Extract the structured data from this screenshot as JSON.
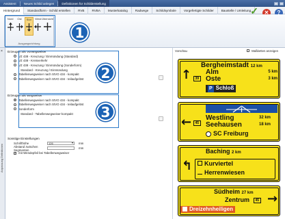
{
  "titlebar": {
    "tabs": [
      "Assistent",
      "Neues Schild anlegen",
      "Definitionen für Schilderstellung"
    ]
  },
  "menubar": {
    "items": [
      "Hintergrund",
      "Standardform - Schild erstellen",
      "RVB",
      "RVBA",
      "Musterkatalog",
      "Radwege",
      "Schildsymbole",
      "Vorgefertigte Schilder",
      "Baustelle / Umleitung"
    ],
    "active_index": 0,
    "confirm_icon": "check-icon",
    "cancel_icon": "close-icon",
    "help_label": "?"
  },
  "ribbon": {
    "buttons": [
      "Nord",
      "Ost",
      "Süd",
      "West",
      "Übersicht"
    ],
    "selected": 2,
    "group_label": "Ausgangsrichtung"
  },
  "callouts": [
    "1",
    "2",
    "3"
  ],
  "sidetab": {
    "close": "×",
    "label": "Anpassung Definitionen"
  },
  "vorwegweiser": {
    "header": "Erzeugen als Vorwegweiser",
    "options": [
      {
        "label": "VZ 438 - Kreuzung / Einmündung (Standard)",
        "sub": false,
        "on": false
      },
      {
        "label": "VZ 438 - Kreisverkehr",
        "sub": false,
        "on": false
      },
      {
        "label": "VZ 438 - Kreuzung / Einmündung (Sonderform)",
        "sub": false,
        "on": false
      },
      {
        "label": "Standard - Kreuzung / Einmündung",
        "sub": true,
        "on": false
      },
      {
        "label": "Tabellenwegweiser nach StVO 434 - kompakt",
        "sub": false,
        "on": false
      },
      {
        "label": "Tabellenwegweiser nach StVO 434 - teilaufgelöst",
        "sub": false,
        "on": false
      }
    ]
  },
  "wegweiser": {
    "header": "Erzeugen als Wegweiser",
    "options": [
      {
        "label": "Tabellenwegweiser nach StVO 434 - kompakt",
        "sub": false,
        "on": true
      },
      {
        "label": "Tabellenwegweiser nach StVO 434 - teilaufgelöst",
        "sub": false,
        "on": false
      },
      {
        "label": "Sonderform",
        "sub": false,
        "on": false
      },
      {
        "label": "Standard - Tabellenwegweiser-kompakt",
        "sub": true,
        "on": false
      }
    ]
  },
  "settings": {
    "header": "Sonstige Einstellungen",
    "font_size_label": "Schrifthöhe",
    "font_size_value": "126",
    "font_size_unit": "mm",
    "spacing_label": "Abstand zwischen Segmenten",
    "spacing_value": "",
    "spacing_unit": "mm",
    "checkbox_label": "mit Wendepfeil bei Tabellenwegweiser",
    "checkbox_checked": true
  },
  "preview": {
    "label": "Vorschau",
    "checkbox_label": "Maßketten anzeigen",
    "sign1": {
      "rows": [
        {
          "name": "Bergheimstadt",
          "km": "12 km"
        },
        {
          "name": "Alm",
          "km": "5 km"
        },
        {
          "name": "Oste",
          "km": "3 km"
        }
      ],
      "route": "39",
      "poi": "Schloß",
      "poi_icon": "P"
    },
    "sign2": {
      "rows": [
        {
          "name": "Westling",
          "km": "32 km"
        },
        {
          "name": "Seehausen",
          "km": "18 km"
        }
      ],
      "route": "45",
      "poi": "SC Freiburg"
    },
    "sign3": {
      "title": "Baching",
      "title_km": "2 km",
      "rows": [
        "Kurviertel",
        "Herrenwiesen"
      ]
    },
    "sign4": {
      "title": "Südheim",
      "title_km": "27 km",
      "row": "Zentrum",
      "route": "45",
      "poi": "Dreizehnheiligen"
    }
  }
}
